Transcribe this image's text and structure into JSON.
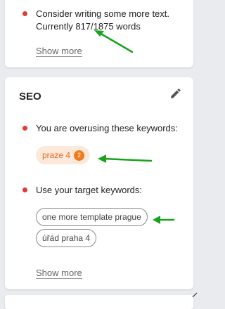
{
  "top_card": {
    "message_line1": "Consider writing some more text.",
    "message_line2": "Currently 817/1875 words",
    "show_more": "Show more"
  },
  "seo_card": {
    "title": "SEO",
    "overused_label": "You are overusing these keywords:",
    "overused_keywords": [
      {
        "label": "praze 4",
        "count": "2"
      }
    ],
    "target_label": "Use your target keywords:",
    "target_keywords": [
      "one more template prague",
      "úřád praha 4"
    ],
    "show_more": "Show more"
  },
  "icons": {
    "edit": "pencil-icon",
    "status_dot": "red-dot-icon",
    "annotation": "green-arrow"
  },
  "colors": {
    "dot": "#e53935",
    "chip_orange_bg": "#fde9dc",
    "chip_orange_text": "#e66a17",
    "badge": "#f07a1a",
    "arrow": "#18a31a"
  }
}
